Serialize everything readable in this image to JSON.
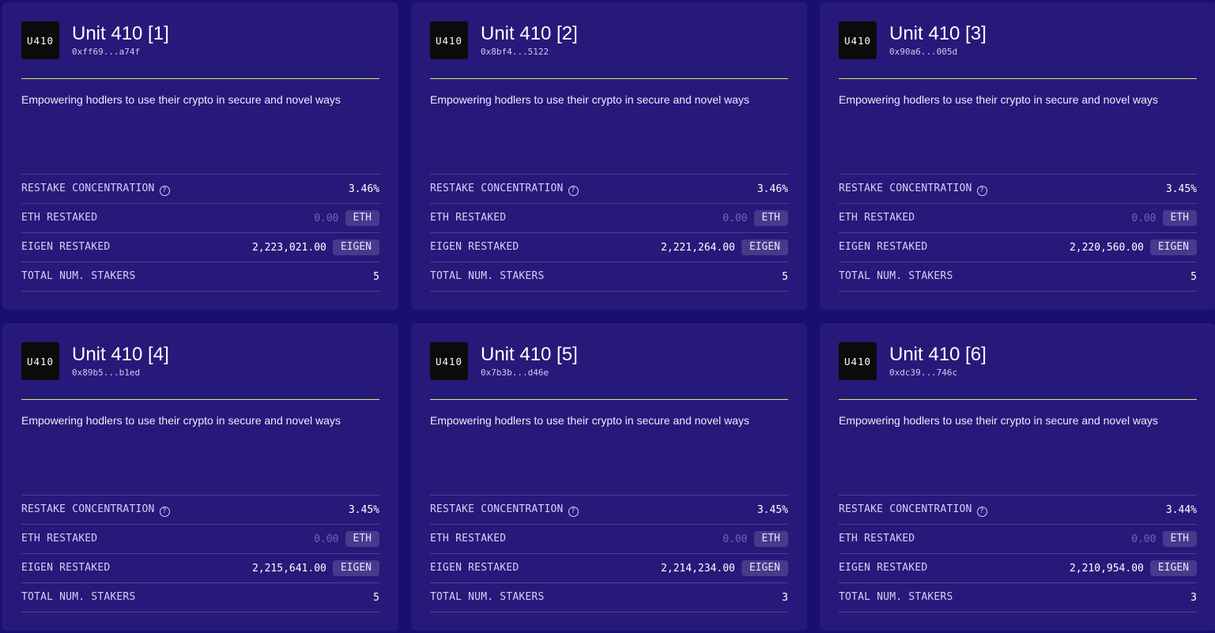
{
  "colors": {
    "page_background": "#1a0f6e",
    "card_background": "#27197a",
    "accent_line": "#c9f06a",
    "badge_background": "#463a8c"
  },
  "labels": {
    "restake_concentration": "RESTAKE CONCENTRATION",
    "eth_restaked": "ETH RESTAKED",
    "eigen_restaked": "EIGEN RESTAKED",
    "total_num_stakers": "TOTAL NUM. STAKERS",
    "info_icon_glyph": "?"
  },
  "cards": [
    {
      "logo_text": "U410",
      "name": "Unit 410 [1]",
      "address": "0xff69...a74f",
      "description": "Empowering hodlers to use their crypto in secure and novel ways",
      "restake_concentration": "3.46%",
      "eth_restaked": "0.00",
      "eth_unit": "ETH",
      "eigen_restaked": "2,223,021.00",
      "eigen_unit": "EIGEN",
      "total_num_stakers": "5"
    },
    {
      "logo_text": "U410",
      "name": "Unit 410 [2]",
      "address": "0x8bf4...5122",
      "description": "Empowering hodlers to use their crypto in secure and novel ways",
      "restake_concentration": "3.46%",
      "eth_restaked": "0.00",
      "eth_unit": "ETH",
      "eigen_restaked": "2,221,264.00",
      "eigen_unit": "EIGEN",
      "total_num_stakers": "5"
    },
    {
      "logo_text": "U410",
      "name": "Unit 410 [3]",
      "address": "0x90a6...005d",
      "description": "Empowering hodlers to use their crypto in secure and novel ways",
      "restake_concentration": "3.45%",
      "eth_restaked": "0.00",
      "eth_unit": "ETH",
      "eigen_restaked": "2,220,560.00",
      "eigen_unit": "EIGEN",
      "total_num_stakers": "5"
    },
    {
      "logo_text": "U410",
      "name": "Unit 410 [4]",
      "address": "0x89b5...b1ed",
      "description": "Empowering hodlers to use their crypto in secure and novel ways",
      "restake_concentration": "3.45%",
      "eth_restaked": "0.00",
      "eth_unit": "ETH",
      "eigen_restaked": "2,215,641.00",
      "eigen_unit": "EIGEN",
      "total_num_stakers": "5"
    },
    {
      "logo_text": "U410",
      "name": "Unit 410 [5]",
      "address": "0x7b3b...d46e",
      "description": "Empowering hodlers to use their crypto in secure and novel ways",
      "restake_concentration": "3.45%",
      "eth_restaked": "0.00",
      "eth_unit": "ETH",
      "eigen_restaked": "2,214,234.00",
      "eigen_unit": "EIGEN",
      "total_num_stakers": "3"
    },
    {
      "logo_text": "U410",
      "name": "Unit 410 [6]",
      "address": "0xdc39...746c",
      "description": "Empowering hodlers to use their crypto in secure and novel ways",
      "restake_concentration": "3.44%",
      "eth_restaked": "0.00",
      "eth_unit": "ETH",
      "eigen_restaked": "2,210,954.00",
      "eigen_unit": "EIGEN",
      "total_num_stakers": "3"
    }
  ]
}
